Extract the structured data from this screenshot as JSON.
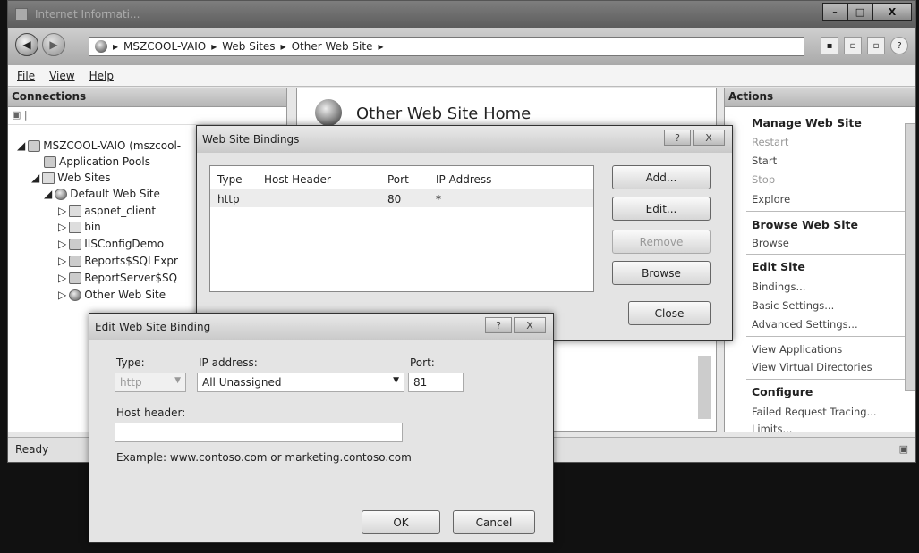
{
  "window": {
    "title": "Internet Informati...",
    "buttons": {
      "minimize": "–",
      "maximize": "□",
      "close": "X"
    }
  },
  "address": {
    "crumbs": [
      "MSZCOOL-VAIO",
      "Web Sites",
      "Other Web Site"
    ],
    "separator": "▸"
  },
  "menu": {
    "file": "File",
    "view": "View",
    "help": "Help"
  },
  "connections": {
    "header": "Connections",
    "tree": [
      {
        "label": "MSZCOOL-VAIO (mszcool-",
        "icon": "server-icon"
      },
      {
        "label": "Application Pools",
        "icon": "app-pool-icon"
      },
      {
        "label": "Web Sites",
        "icon": "folder-icon"
      },
      {
        "label": "Default Web Site",
        "icon": "globe-icon"
      },
      {
        "label": "aspnet_client",
        "icon": "folder-icon"
      },
      {
        "label": "bin",
        "icon": "folder-icon"
      },
      {
        "label": "IISConfigDemo",
        "icon": "app-icon"
      },
      {
        "label": "Reports$SQLExpr",
        "icon": "app-icon"
      },
      {
        "label": "ReportServer$SQ",
        "icon": "app-icon"
      },
      {
        "label": "Other Web Site",
        "icon": "globe-icon"
      }
    ]
  },
  "center": {
    "title": "Other Web Site Home"
  },
  "actions": {
    "header": "Actions",
    "groups": [
      {
        "heading": "Manage Web Site",
        "items": [
          "Restart",
          "Start",
          "Stop",
          "Explore"
        ]
      },
      {
        "heading": "Browse Web Site",
        "items": [
          "Browse"
        ]
      },
      {
        "heading": "Edit Site",
        "items": [
          "Bindings...",
          "Basic Settings...",
          "Advanced Settings..."
        ]
      },
      {
        "heading": "",
        "items": [
          "View Applications",
          "View Virtual Directories"
        ]
      },
      {
        "heading": "Configure",
        "items": [
          "Failed Request Tracing...",
          "Limits..."
        ]
      }
    ]
  },
  "status": {
    "text": "Ready"
  },
  "bindings_dialog": {
    "title": "Web Site Bindings",
    "help": "?",
    "close_x": "X",
    "columns": [
      "Type",
      "Host Header",
      "Port",
      "IP Address"
    ],
    "rows": [
      {
        "type": "http",
        "host": "",
        "port": "80",
        "ip": "*"
      }
    ],
    "buttons": {
      "add": "Add...",
      "edit": "Edit...",
      "remove": "Remove",
      "browse": "Browse",
      "close": "Close"
    }
  },
  "edit_dialog": {
    "title": "Edit Web Site Binding",
    "help": "?",
    "close_x": "X",
    "type_label": "Type:",
    "type_value": "http",
    "ip_label": "IP address:",
    "ip_value": "All Unassigned",
    "port_label": "Port:",
    "port_value": "81",
    "host_label": "Host header:",
    "host_value": "",
    "example": "Example: www.contoso.com or marketing.contoso.com",
    "ok": "OK",
    "cancel": "Cancel"
  }
}
